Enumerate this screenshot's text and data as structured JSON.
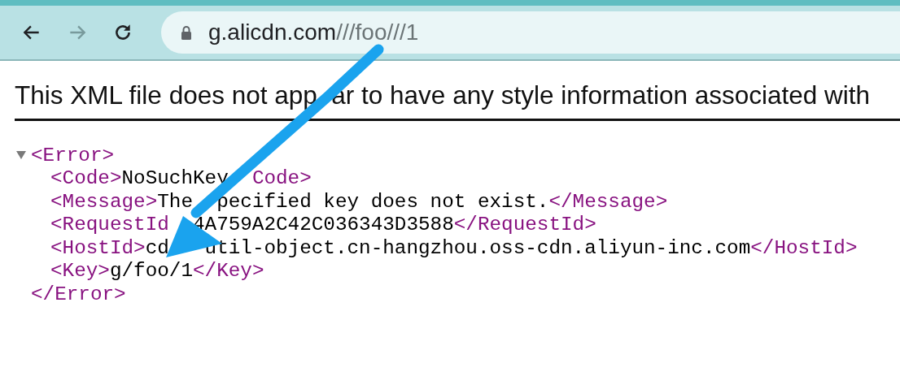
{
  "toolbar": {
    "back_disabled": false,
    "forward_disabled": true,
    "url_host": "g.alicdn.com",
    "url_path": "///foo///1"
  },
  "notice": [
    "This XML file does not app",
    "ar to have any style information associated with"
  ],
  "xml": {
    "expanded": true,
    "open_tag": "<Error>",
    "close_tag": "</Error>",
    "lines": [
      {
        "parts": [
          [
            {
              "kind": "tag",
              "text": "<Code>"
            },
            {
              "kind": "text",
              "text": "NoSuchKey"
            }
          ],
          [
            {
              "kind": "tag",
              "text": "Code>"
            }
          ]
        ]
      },
      {
        "parts": [
          [
            {
              "kind": "tag",
              "text": "<Message>"
            },
            {
              "kind": "text",
              "text": "The"
            }
          ],
          [
            {
              "kind": "text",
              "text": "pecified key does not exist."
            },
            {
              "kind": "tag",
              "text": "</Message>"
            }
          ]
        ]
      },
      {
        "parts": [
          [
            {
              "kind": "tag",
              "text": "<RequestId"
            }
          ],
          [
            {
              "kind": "text",
              "text": "4A759A2C42C036343D3588"
            },
            {
              "kind": "tag",
              "text": "</RequestId>"
            }
          ]
        ]
      },
      {
        "parts": [
          [
            {
              "kind": "tag",
              "text": "<HostId>"
            },
            {
              "kind": "text",
              "text": "cd"
            }
          ],
          [
            {
              "kind": "text",
              "text": "util-object.cn-hangzhou.oss-cdn.aliyun-inc.com"
            },
            {
              "kind": "tag",
              "text": "</HostId>"
            }
          ]
        ]
      },
      {
        "parts": [
          [
            {
              "kind": "tag",
              "text": "<Key>"
            },
            {
              "kind": "text",
              "text": "g/foo/1"
            },
            {
              "kind": "tag",
              "text": "</Key>"
            }
          ]
        ]
      }
    ]
  }
}
